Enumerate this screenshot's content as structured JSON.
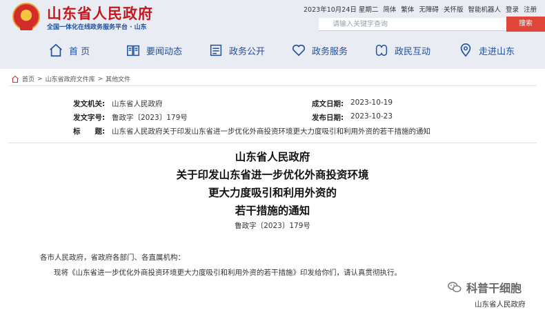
{
  "header": {
    "site_title": "山东省人民政府",
    "site_subtitle": "全国一体化在线政务服务平台 · 山东",
    "topbar": [
      "2023年10月24日 星期二",
      "简体",
      "繁体",
      "无障碍",
      "关怀版",
      "智能机器人",
      "登录",
      "注册"
    ],
    "search_placeholder": "请输入关键字查询",
    "search_button": "搜索"
  },
  "nav": [
    {
      "label": "首 页",
      "icon": "home-icon"
    },
    {
      "label": "要闻动态",
      "icon": "book-icon"
    },
    {
      "label": "政务公开",
      "icon": "document-icon"
    },
    {
      "label": "政务服务",
      "icon": "heart-icon"
    },
    {
      "label": "政民互动",
      "icon": "interaction-icon"
    },
    {
      "label": "走进山东",
      "icon": "location-icon"
    }
  ],
  "breadcrumb": [
    "首页",
    "山东省政府文件库",
    "其他文件"
  ],
  "breadcrumb_sep": ">",
  "meta": {
    "issuer_label": "发文机关:",
    "issuer": "山东省人民政府",
    "docno_label": "发文字号:",
    "docno": "鲁政字〔2023〕179号",
    "title_label": "标　　题:",
    "title": "山东省人民政府关于印发山东省进一步优化外商投资环境更大力度吸引和利用外资的若干措施的通知",
    "created_label": "成文日期:",
    "created": "2023-10-19",
    "published_label": "发布日期:",
    "published": "2023-10-23"
  },
  "doc": {
    "title_lines": [
      "山东省人民政府",
      "关于印发山东省进一步优化外商投资环境",
      "更大力度吸引和利用外资的",
      "若干措施的通知"
    ],
    "doc_no": "鲁政字〔2023〕179号",
    "salutation": "各市人民政府，省政府各部门、各直属机构：",
    "paragraph": "现将《山东省进一步优化外商投资环境更大力度吸引和利用外资的若干措施》印发给你们，请认真贯彻执行。",
    "signature": "山东省人民政府"
  },
  "watermark": "科普干细胞"
}
